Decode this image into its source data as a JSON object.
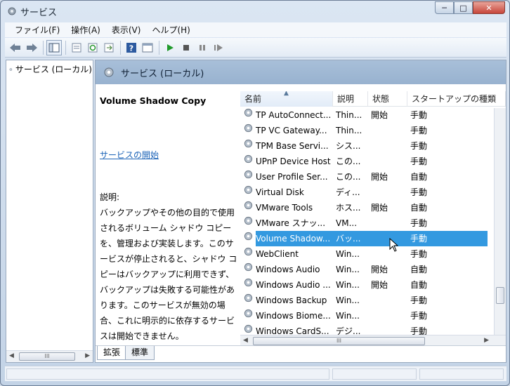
{
  "window": {
    "title": "サービス",
    "minimize": "─",
    "maximize": "□",
    "close": "✕"
  },
  "menu": [
    "ファイル(F)",
    "操作(A)",
    "表示(V)",
    "ヘルプ(H)"
  ],
  "toolbar_icons": [
    "back-icon",
    "forward-icon",
    "show-tree-icon",
    "export-list-icon",
    "refresh-icon",
    "properties-icon",
    "help-icon",
    "console-icon",
    "start-service-icon",
    "stop-service-icon",
    "pause-service-icon",
    "restart-service-icon"
  ],
  "tree": {
    "item": "サービス (ローカル)"
  },
  "main": {
    "header": "サービス (ローカル)",
    "service_title": "Volume Shadow Copy",
    "start_link": "サービスの開始",
    "desc_label": "説明:",
    "description": "バックアップやその他の目的で使用されるボリューム シャドウ コピーを、管理および実装します。このサービスが停止されると、シャドウ コピーはバックアップに利用できず、バックアップは失敗する可能性があります。このサービスが無効の場合、これに明示的に依存するサービスは開始できません。"
  },
  "list": {
    "columns": {
      "name": "名前",
      "desc": "説明",
      "status": "状態",
      "startup": "スタートアップの種類"
    },
    "rows": [
      {
        "name": "TP AutoConnect...",
        "desc": "Thin...",
        "status": "開始",
        "startup": "手動"
      },
      {
        "name": "TP VC Gateway...",
        "desc": "Thin...",
        "status": "",
        "startup": "手動"
      },
      {
        "name": "TPM Base Servi...",
        "desc": "シス...",
        "status": "",
        "startup": "手動"
      },
      {
        "name": "UPnP Device Host",
        "desc": "この...",
        "status": "",
        "startup": "手動"
      },
      {
        "name": "User Profile Ser...",
        "desc": "この...",
        "status": "開始",
        "startup": "自動"
      },
      {
        "name": "Virtual Disk",
        "desc": "ディ...",
        "status": "",
        "startup": "手動"
      },
      {
        "name": "VMware Tools",
        "desc": "ホス...",
        "status": "開始",
        "startup": "自動"
      },
      {
        "name": "VMware スナッ...",
        "desc": "VM...",
        "status": "",
        "startup": "手動"
      },
      {
        "name": "Volume Shadow...",
        "desc": "バッ...",
        "status": "",
        "startup": "手動",
        "selected": true
      },
      {
        "name": "WebClient",
        "desc": "Win...",
        "status": "",
        "startup": "手動"
      },
      {
        "name": "Windows Audio",
        "desc": "Win...",
        "status": "開始",
        "startup": "自動"
      },
      {
        "name": "Windows Audio ...",
        "desc": "Win...",
        "status": "開始",
        "startup": "自動"
      },
      {
        "name": "Windows Backup",
        "desc": "Win...",
        "status": "",
        "startup": "手動"
      },
      {
        "name": "Windows Biome...",
        "desc": "Win...",
        "status": "",
        "startup": "手動"
      },
      {
        "name": "Windows CardS...",
        "desc": "デジ...",
        "status": "",
        "startup": "手動"
      }
    ]
  },
  "tabs": {
    "extended": "拡張",
    "standard": "標準"
  },
  "colors": {
    "selection": "#3399e0",
    "header_band": "#a8bfd9",
    "link": "#1b63b7"
  }
}
